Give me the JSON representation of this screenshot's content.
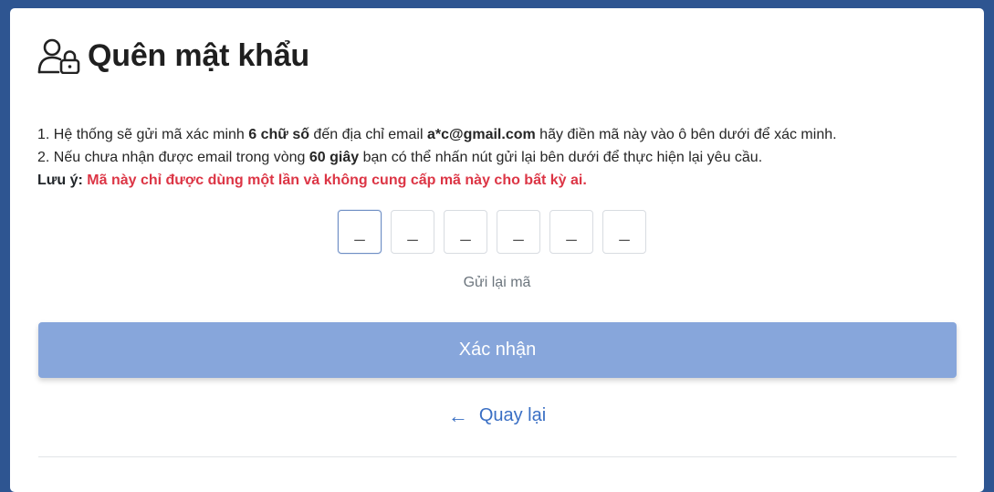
{
  "page": {
    "title": "Quên mật khẩu",
    "header_icon": "user-lock-icon"
  },
  "info": {
    "line1_a": "1. Hệ thống sẽ gửi mã xác minh ",
    "line1_digits": "6 chữ số",
    "line1_b": " đến địa chỉ email ",
    "line1_email": "a*c@gmail.com",
    "line1_c": " hãy điền mã này vào ô bên dưới để xác minh.",
    "line2_a": "2. Nếu chưa nhận được email trong vòng ",
    "line2_seconds": "60 giây",
    "line2_b": " bạn có thể nhấn nút gửi lại bên dưới để thực hiện lại yêu cầu.",
    "note_label": "Lưu ý:",
    "note_text": "Mã này chỉ được dùng một lần và không cung cấp mã này cho bất kỳ ai."
  },
  "otp": {
    "placeholders": [
      "_",
      "_",
      "_",
      "_",
      "_",
      "_"
    ]
  },
  "resend_label": "Gửi lại mã",
  "submit_label": "Xác nhận",
  "back": {
    "arrow": "←",
    "label": "Quay lại"
  },
  "colors": {
    "background": "#2e5591",
    "accent": "#3a6fc4",
    "button": "#87a6db",
    "warning": "#dc3545"
  }
}
